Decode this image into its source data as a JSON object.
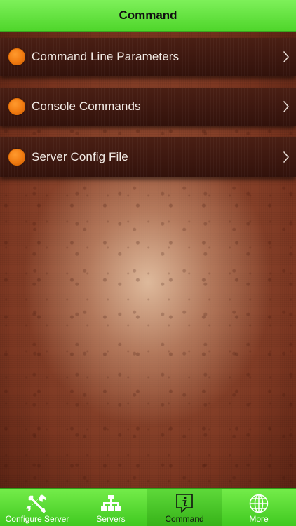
{
  "nav": {
    "title": "Command"
  },
  "menu": {
    "items": [
      {
        "label": "Command Line Parameters"
      },
      {
        "label": "Console Commands"
      },
      {
        "label": "Server Config File"
      }
    ]
  },
  "tabbar": {
    "selected": "Command",
    "tabs": [
      {
        "label": "Configure Server",
        "icon": "tools-icon"
      },
      {
        "label": "Servers",
        "icon": "network-icon"
      },
      {
        "label": "Command",
        "icon": "info-bubble-icon"
      },
      {
        "label": "More",
        "icon": "globe-icon"
      }
    ]
  },
  "colors": {
    "bar_green": "#5ad932",
    "row_brown": "#3c170f",
    "dot_orange": "#f07a10",
    "row_text": "#f3ece6"
  }
}
